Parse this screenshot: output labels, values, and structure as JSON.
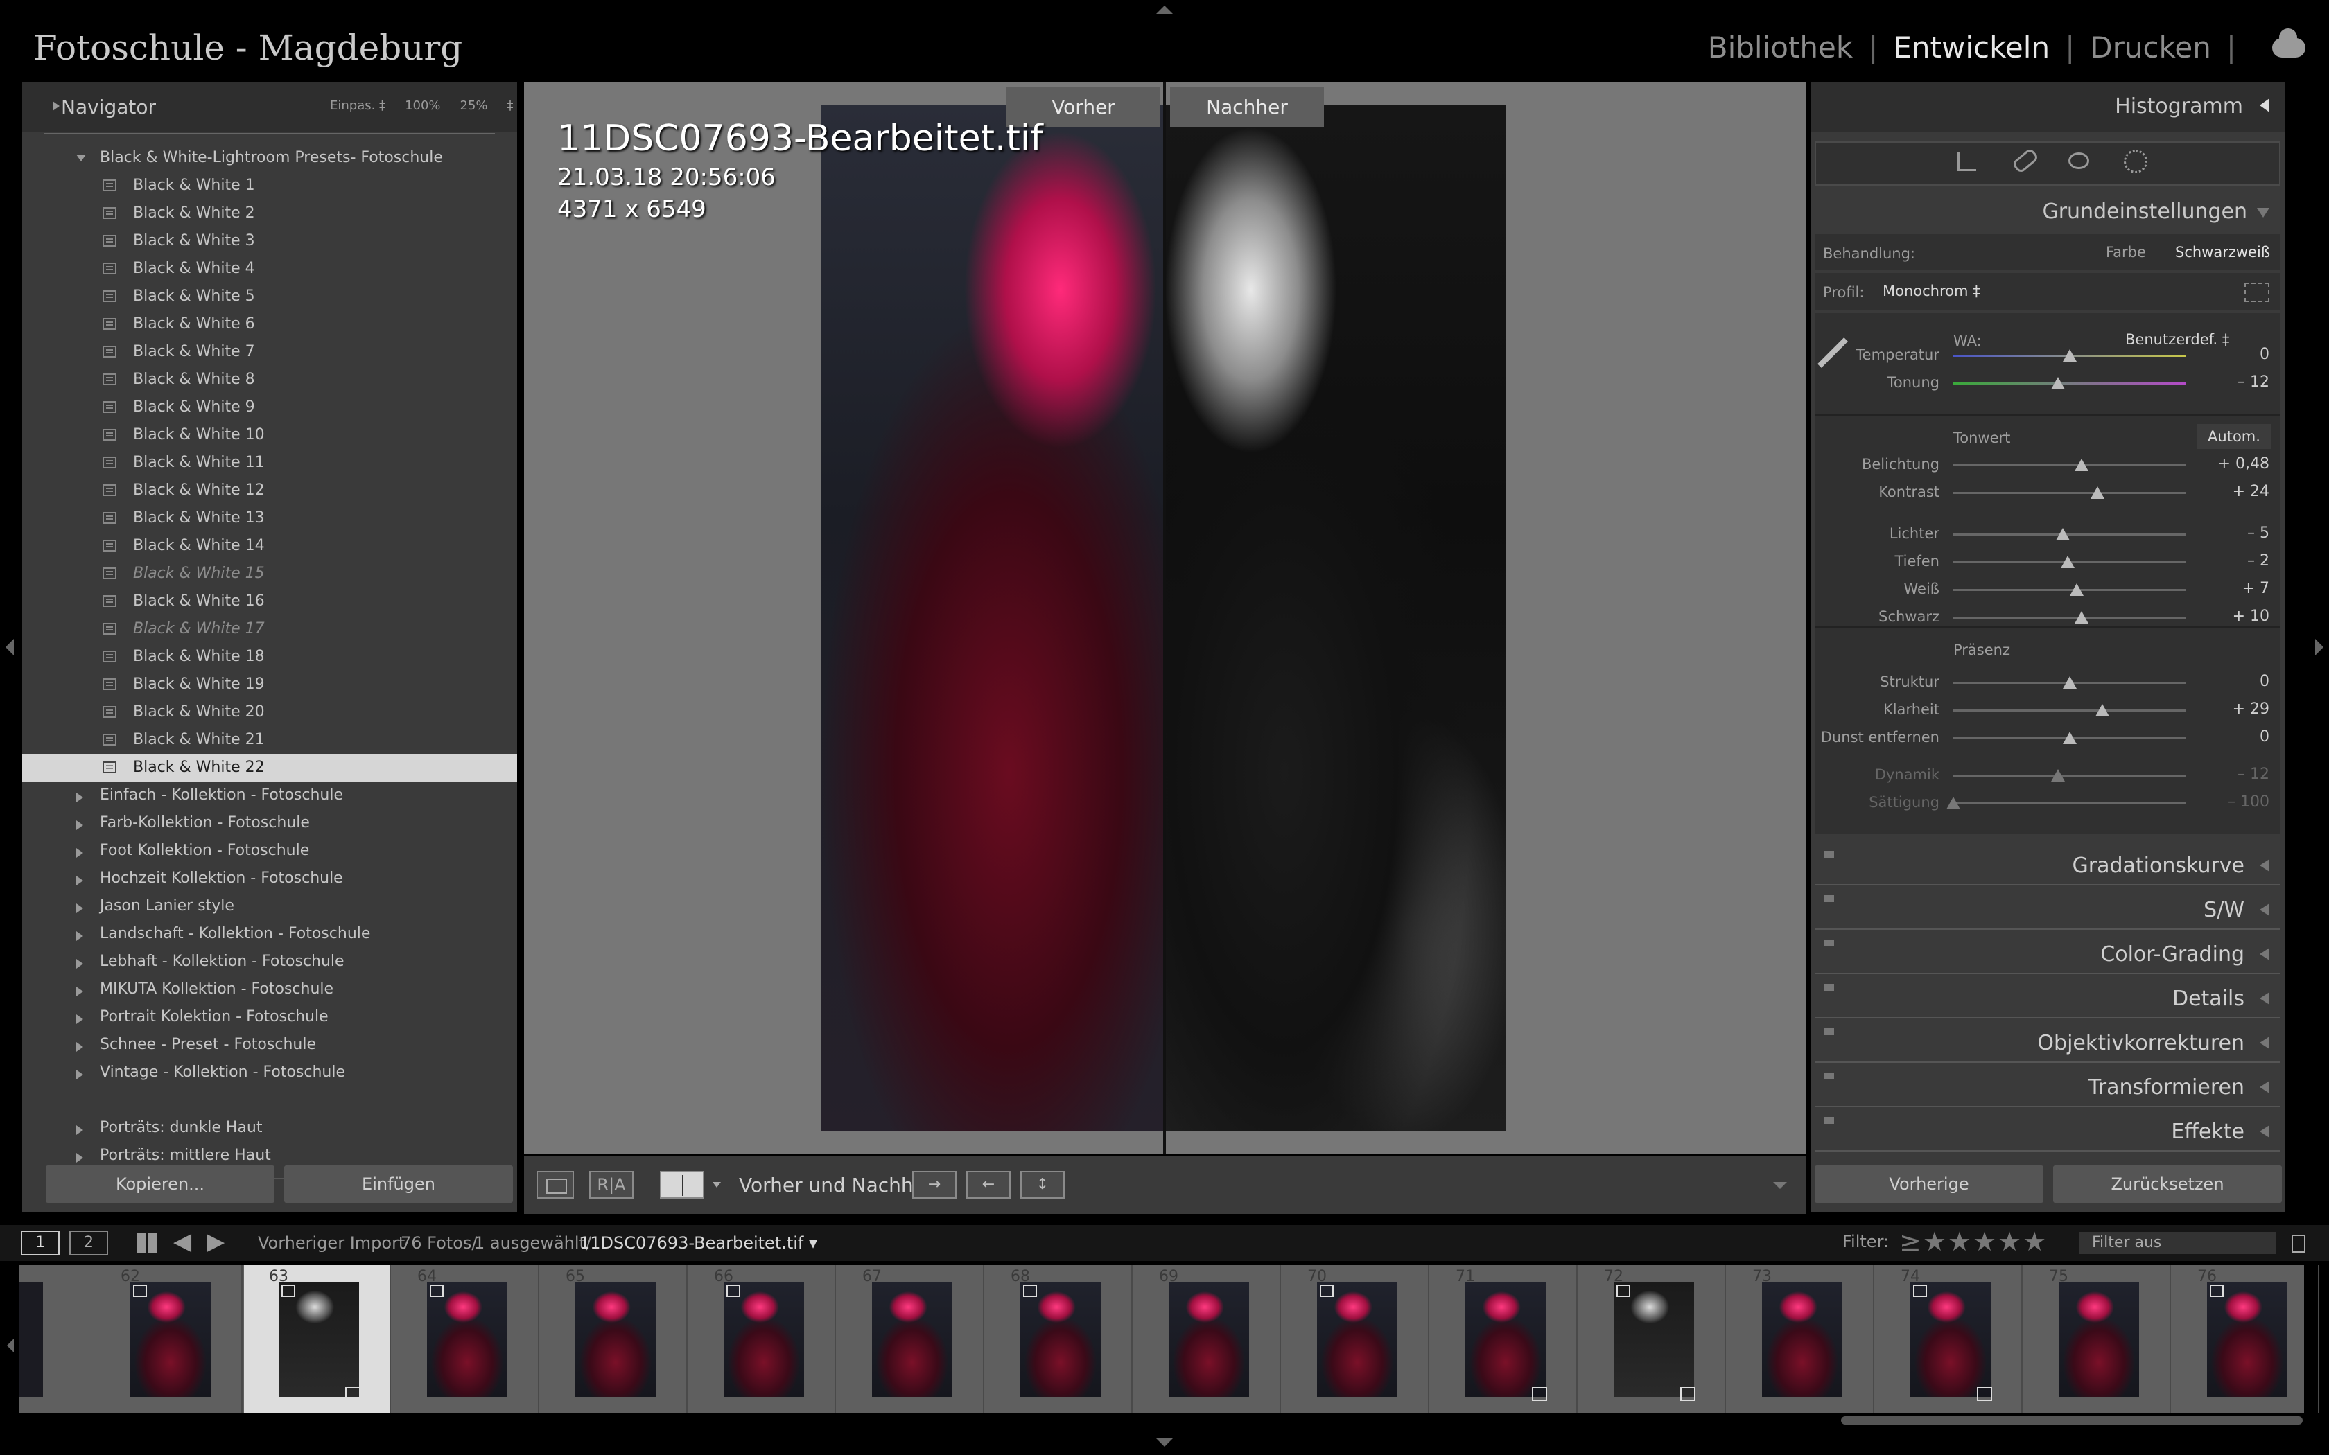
{
  "app": {
    "studio_title": "Fotoschule - Magdeburg",
    "modules": [
      "Bibliothek",
      "Entwickeln",
      "Drucken"
    ],
    "active_module": "Entwickeln"
  },
  "navigator": {
    "title": "Navigator",
    "zoom_options": [
      "Einpas. ‡",
      "100%",
      "25%",
      "‡"
    ]
  },
  "presets": {
    "expanded_group": "Black & White-Lightroom Presets- Fotoschule",
    "items": [
      "Black & White 1",
      "Black & White 2",
      "Black & White 3",
      "Black & White 4",
      "Black & White 5",
      "Black & White 6",
      "Black & White 7",
      "Black & White 8",
      "Black & White 9",
      "Black & White 10",
      "Black & White 11",
      "Black & White 12",
      "Black & White 13",
      "Black & White 14",
      "Black & White 15",
      "Black & White 16",
      "Black & White 17",
      "Black & White 18",
      "Black & White 19",
      "Black & White 20",
      "Black & White 21",
      "Black & White 22"
    ],
    "dimmed_items": [
      "Black & White 15",
      "Black & White 17"
    ],
    "selected_item": "Black & White 22",
    "groups": [
      "Einfach - Kollektion - Fotoschule",
      "Farb-Kollektion - Fotoschule",
      "Foot Kollektion - Fotoschule",
      "Hochzeit Kollektion - Fotoschule",
      "Jason Lanier style",
      "Landschaft - Kollektion - Fotoschule",
      "Lebhaft - Kollektion - Fotoschule",
      "MIKUTA Kollektion - Fotoschule",
      "Portrait Kolektion - Fotoschule",
      "Schnee - Preset - Fotoschule",
      "Vintage - Kollektion - Fotoschule"
    ],
    "extra_groups": [
      "Porträts: dunkle Haut",
      "Porträts: mittlere Haut"
    ]
  },
  "left_buttons": {
    "copy": "Kopieren...",
    "paste": "Einfügen"
  },
  "viewer": {
    "before_label": "Vorher",
    "after_label": "Nachher",
    "filename": "11DSC07693-Bearbeitet.tif",
    "datetime": "21.03.18 20:56:06",
    "dimensions": "4371 x 6549"
  },
  "toolbar": {
    "before_after_label": "Vorher und Nachher:",
    "ra_icons": "R|A"
  },
  "right_panel": {
    "histogram": "Histogramm",
    "basic": "Grundeinstellungen",
    "treatment_label": "Behandlung:",
    "treatment_options": [
      "Farbe",
      "Schwarzweiß"
    ],
    "treatment_selected": "Schwarzweiß",
    "profile_label": "Profil:",
    "profile_value": "Monochrom ‡",
    "wb_label": "WA:",
    "wb_value": "Benutzerdef. ‡",
    "tone_label": "Tonwert",
    "auto_label": "Autom.",
    "presence_label": "Präsenz",
    "sliders": [
      {
        "label": "Temperatur",
        "value": "0",
        "pos": 0.5
      },
      {
        "label": "Tonung",
        "value": "– 12",
        "pos": 0.45
      },
      {
        "label": "Belichtung",
        "value": "+ 0,48",
        "pos": 0.55
      },
      {
        "label": "Kontrast",
        "value": "+ 24",
        "pos": 0.62
      },
      {
        "label": "Lichter",
        "value": "– 5",
        "pos": 0.47
      },
      {
        "label": "Tiefen",
        "value": "– 2",
        "pos": 0.49
      },
      {
        "label": "Weiß",
        "value": "+ 7",
        "pos": 0.53
      },
      {
        "label": "Schwarz",
        "value": "+ 10",
        "pos": 0.55
      },
      {
        "label": "Struktur",
        "value": "0",
        "pos": 0.5
      },
      {
        "label": "Klarheit",
        "value": "+ 29",
        "pos": 0.64
      },
      {
        "label": "Dunst entfernen",
        "value": "0",
        "pos": 0.5
      },
      {
        "label": "Dynamik",
        "value": "– 12",
        "pos": 0.45
      },
      {
        "label": "Sättigung",
        "value": "– 100",
        "pos": 0.0
      }
    ],
    "panels": [
      "Gradationskurve",
      "S/W",
      "Color-Grading",
      "Details",
      "Objektivkorrekturen",
      "Transformieren",
      "Effekte"
    ],
    "prev_button": "Vorherige",
    "reset_button": "Zurücksetzen"
  },
  "filmstrip_bar": {
    "view1": "1",
    "view2": "2",
    "source": "Vorheriger Import",
    "count": "76 Fotos/",
    "selected": "1 ausgewählt/",
    "file": "11DSC07693-Bearbeitet.tif ▾",
    "filter_label": "Filter:",
    "filter_value": "Filter aus"
  },
  "filmstrip": {
    "numbers": [
      "62",
      "63",
      "64",
      "65",
      "66",
      "67",
      "68",
      "69",
      "70",
      "71",
      "72",
      "73",
      "74",
      "75",
      "76"
    ],
    "selected_index": 1
  },
  "colors": {
    "panel_bg": "#3a3a3a",
    "viewer_bg": "#777777",
    "selection": "#d6d6d6"
  }
}
